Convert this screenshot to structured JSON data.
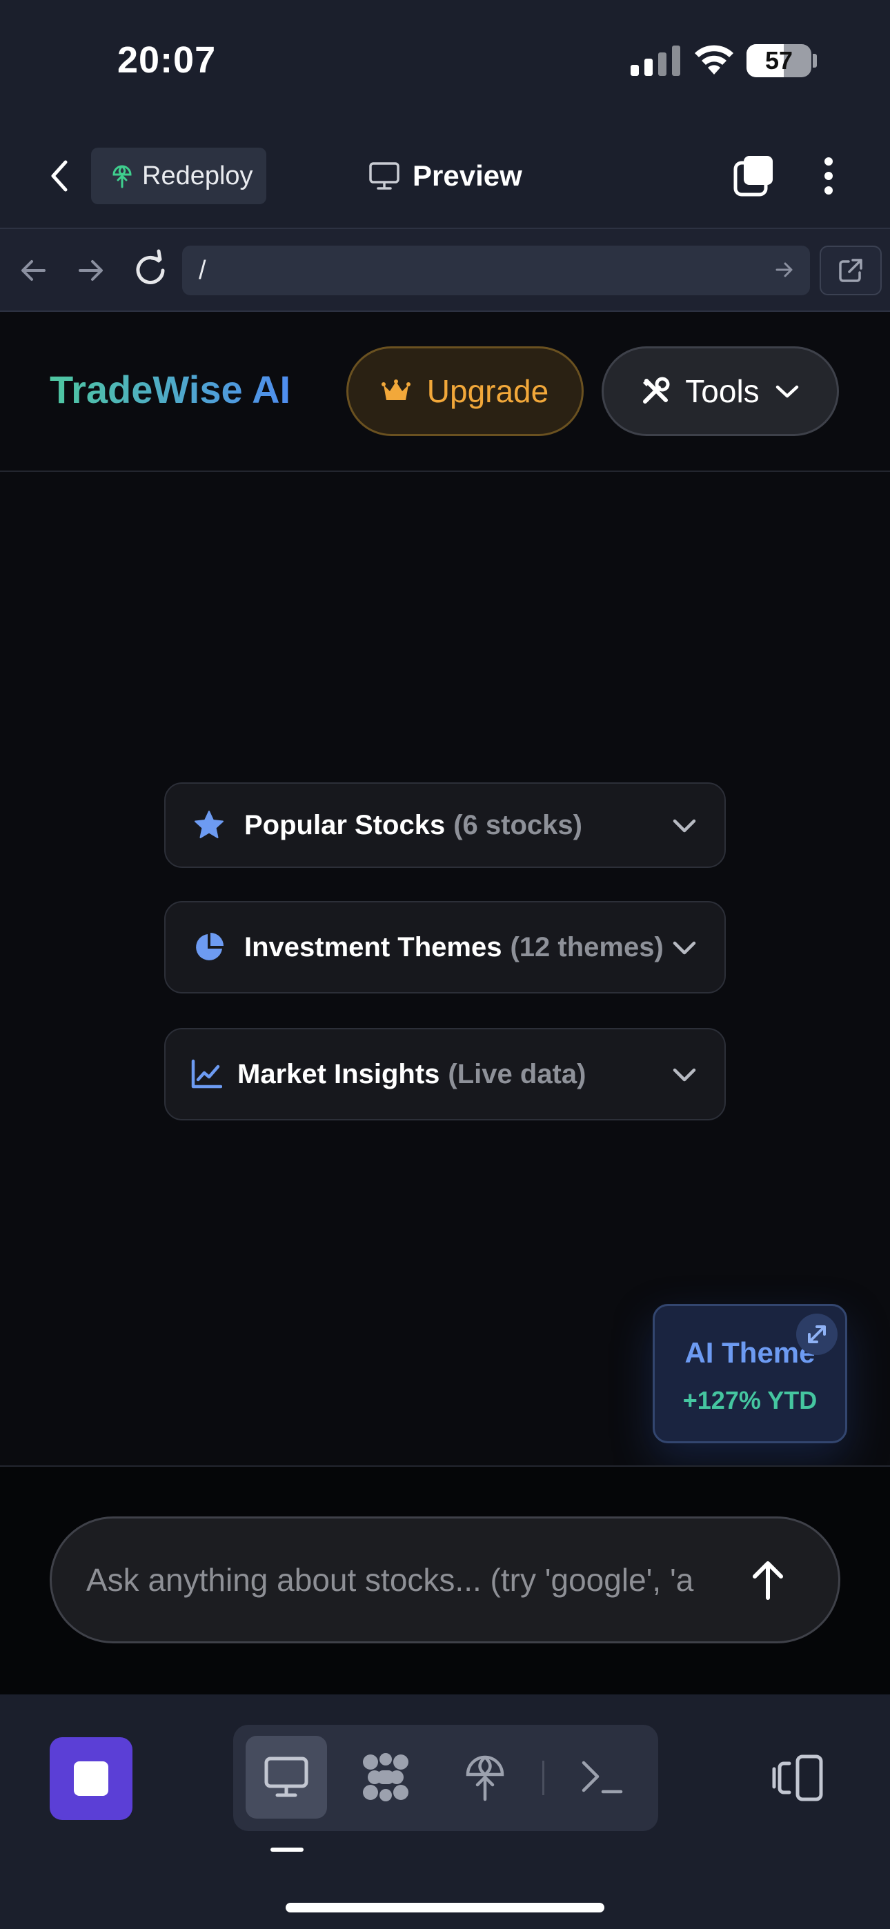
{
  "status_bar": {
    "time": "20:07",
    "battery_level": "57",
    "battery_fraction": 0.57,
    "icons": [
      "signal-icon",
      "wifi-icon",
      "battery-icon"
    ]
  },
  "browser_chrome": {
    "back_icon": "chevron-left-icon",
    "redeploy_label": "Redeploy",
    "redeploy_icon": "deploy-globe-icon",
    "preview_label": "Preview",
    "preview_icon": "monitor-icon",
    "url": "/",
    "colors": {
      "chrome_bg": "#1b1f2c",
      "url_field_bg": "#2c3242"
    }
  },
  "app": {
    "brand": "TradeWise AI",
    "upgrade_label": "Upgrade",
    "upgrade_icon": "crown-icon",
    "tools_label": "Tools",
    "tools_icon": "tools-icon",
    "colors": {
      "brand_gradient_start": "#4fc7a0",
      "brand_gradient_end": "#4f8df0",
      "upgrade": "#f2a83a",
      "accent_blue": "#6d9bf2",
      "positive_green": "#45c6a0"
    }
  },
  "sections": [
    {
      "title": "Popular Stocks",
      "subtitle": "(6 stocks)",
      "icon": "star-icon"
    },
    {
      "title": "Investment Themes",
      "subtitle": "(12 themes)",
      "icon": "pie-chart-icon"
    },
    {
      "title": "Market Insights",
      "subtitle": "(Live data)",
      "icon": "line-chart-icon"
    }
  ],
  "ai_theme_card": {
    "title": "AI Theme",
    "stat": "+127% YTD",
    "icon": "expand-icon"
  },
  "chat": {
    "placeholder": "Ask anything about stocks... (try 'google', 'a",
    "send_icon": "arrow-up-icon"
  },
  "toolbar": {
    "stop_icon": "stop-icon",
    "views": [
      "desktop-icon",
      "design-icon",
      "deploy-globe-icon",
      "terminal-icon"
    ],
    "active_view": "desktop-icon",
    "split_icon": "split-view-icon"
  }
}
